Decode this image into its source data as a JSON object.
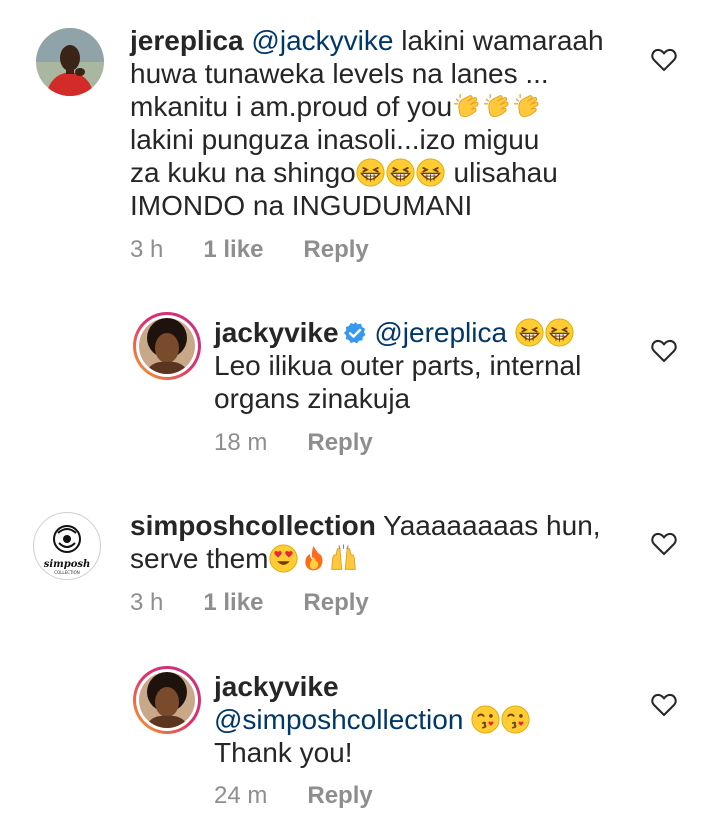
{
  "comments": [
    {
      "username": "jereplica",
      "mention": "@jackyvike",
      "lines": [
        " lakini wamaraah",
        "huwa tunaweka levels na lanes ...",
        "mkanitu i am.proud of you",
        "lakini punguza inasoli...izo miguu",
        "za kuku na shingo",
        " ulisahau",
        "IMONDO na INGUDUMANI"
      ],
      "time": "3 h",
      "likes": "1 like",
      "reply": "Reply"
    },
    {
      "username": "jackyvike",
      "mention": "@jereplica",
      "lines": [
        "Leo ilikua outer parts, internal",
        "organs zinakuja"
      ],
      "time": "18 m",
      "reply": "Reply"
    },
    {
      "username": "simposhcollection",
      "lines": [
        " Yaaaaaaaas hun,",
        "serve them"
      ],
      "time": "3 h",
      "likes": "1 like",
      "reply": "Reply",
      "logo_text": "simposh",
      "logo_subtext": "COLLECTION"
    },
    {
      "username": "jackyvike",
      "mention": "@simposhcollection",
      "lines": [
        "Thank you!"
      ],
      "time": "24 m",
      "reply": "Reply"
    }
  ],
  "icons": {
    "like": "heart-outline-icon",
    "verified": "verified-badge-icon",
    "emojis": [
      "clapping-hands",
      "grinning-squinting-face",
      "smiling-heart-eyes",
      "fire",
      "raising-hands",
      "face-blowing-kiss"
    ]
  },
  "colors": {
    "text": "#262626",
    "secondary": "#8e8e8e",
    "mention": "#00376b",
    "verified": "#3897f0"
  }
}
